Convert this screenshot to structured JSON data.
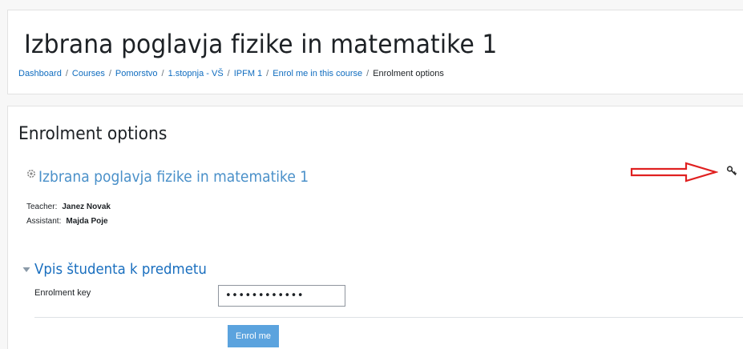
{
  "header": {
    "title": "Izbrana poglavja fizike in matematike 1",
    "breadcrumb": [
      {
        "label": "Dashboard",
        "link": true
      },
      {
        "label": "Courses",
        "link": true
      },
      {
        "label": "Pomorstvo",
        "link": true
      },
      {
        "label": "1.stopnja - VŠ",
        "link": true
      },
      {
        "label": "IPFM 1",
        "link": true
      },
      {
        "label": "Enrol me in this course",
        "link": true
      },
      {
        "label": "Enrolment options",
        "link": false
      }
    ],
    "separator": "/"
  },
  "main": {
    "heading": "Enrolment options",
    "course": {
      "name": "Izbrana poglavja fizike in matematike 1",
      "icon": "course-icon"
    },
    "staff": [
      {
        "role": "Teacher:",
        "name": "Janez Novak"
      },
      {
        "role": "Assistant:",
        "name": "Majda Poje"
      }
    ],
    "annotation": {
      "icon": "red-arrow-icon",
      "color": "#e02020",
      "target_icon": "key-icon"
    },
    "enrol_form": {
      "legend": "Vpis študenta k predmetu",
      "expanded": true,
      "field_label": "Enrolment key",
      "key_value": "••••••••••••",
      "submit_label": "Enrol me"
    }
  },
  "colors": {
    "link": "#0f6cbf",
    "course_link": "#4a90c9",
    "button": "#5ba3de",
    "arrow": "#e02020"
  }
}
